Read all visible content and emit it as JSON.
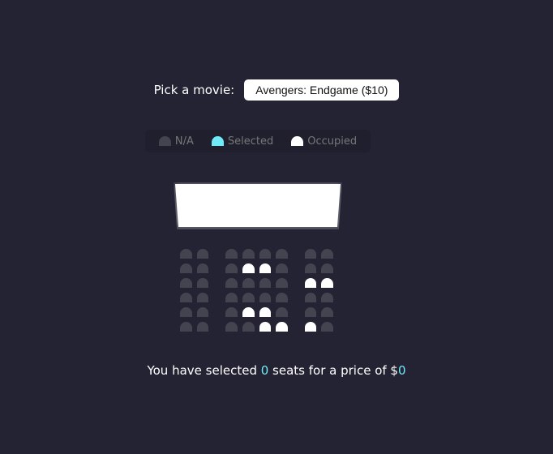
{
  "movie": {
    "label": "Pick a movie:",
    "selected": "Avengers: Endgame ($10)"
  },
  "legend": [
    {
      "label": "N/A",
      "status": "na"
    },
    {
      "label": "Selected",
      "status": "selected"
    },
    {
      "label": "Occupied",
      "status": "occupied"
    }
  ],
  "colors": {
    "background": "#242333",
    "seat_na": "#444451",
    "seat_selected": "#6feaf6",
    "seat_occupied": "#ffffff"
  },
  "seats": [
    [
      "na",
      "na",
      "na",
      "na",
      "na",
      "na",
      "na",
      "na"
    ],
    [
      "na",
      "na",
      "na",
      "occupied",
      "occupied",
      "na",
      "na",
      "na"
    ],
    [
      "na",
      "na",
      "na",
      "na",
      "na",
      "na",
      "occupied",
      "occupied"
    ],
    [
      "na",
      "na",
      "na",
      "na",
      "na",
      "na",
      "na",
      "na"
    ],
    [
      "na",
      "na",
      "na",
      "occupied",
      "occupied",
      "na",
      "na",
      "na"
    ],
    [
      "na",
      "na",
      "na",
      "na",
      "occupied",
      "occupied",
      "occupied",
      "na"
    ]
  ],
  "summary": {
    "prefix": "You have selected ",
    "count": "0",
    "middle": " seats for a price of $",
    "price": "0"
  }
}
